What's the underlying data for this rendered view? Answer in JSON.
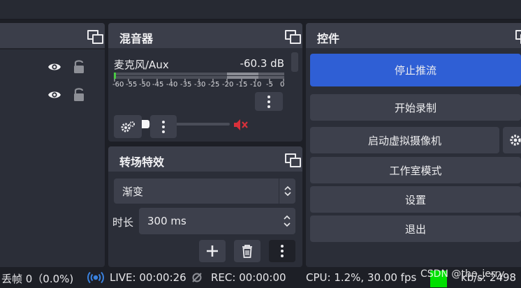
{
  "mixer": {
    "title": "混音器",
    "channel_name": "麦克风/Aux",
    "channel_level": "-60.3 dB",
    "volume_fraction": 0.2,
    "scale_ticks": [
      "-60",
      "-55",
      "-50",
      "-45",
      "-40",
      "-35",
      "-30",
      "-25",
      "-20",
      "-15",
      "-10",
      "-5",
      "0"
    ]
  },
  "transitions": {
    "title": "转场特效",
    "selected": "渐变",
    "duration_label": "时长",
    "duration_value": "300 ms"
  },
  "controls": {
    "title": "控件",
    "buttons": [
      {
        "label": "停止推流"
      },
      {
        "label": "开始录制"
      },
      {
        "label": "启动虚拟摄像机"
      },
      {
        "label": "工作室模式"
      },
      {
        "label": "设置"
      },
      {
        "label": "退出"
      }
    ]
  },
  "status": {
    "dropped": "丢帧 0（0.0%)",
    "live": "LIVE: 00:00:26",
    "rec": "REC: 00:00:00",
    "cpu": "CPU: 1.2%, 30.00 fps",
    "kbs": "kb/s: 2498",
    "watermark": "CSDN @the_jerry"
  },
  "colors": {
    "accent": "#2f5fd5",
    "mute": "#d8303a",
    "meter_green": "#49c843",
    "live_blue": "#3a82e0"
  },
  "icons": [
    "eye-icon",
    "lock-icon",
    "float-icon",
    "mute-icon",
    "gear-icon",
    "more-icon",
    "plus-icon",
    "trash-icon",
    "live-icon",
    "rec-icon"
  ]
}
